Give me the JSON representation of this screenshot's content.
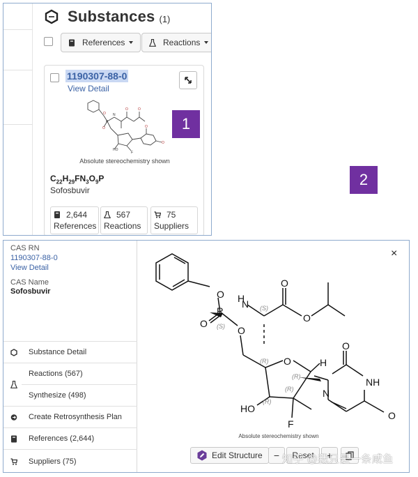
{
  "panel1": {
    "title": "Substances",
    "count": "(1)",
    "buttons": {
      "references": "References",
      "reactions": "Reactions"
    },
    "card": {
      "cas_rn": "1190307-88-0",
      "view_detail": "View Detail",
      "stereo_note": "Absolute stereochemistry shown",
      "formula_parts": [
        "C",
        "22",
        "H",
        "29",
        "FN",
        "3",
        "O",
        "9",
        "P"
      ],
      "name": "Sofosbuvir",
      "stats": [
        {
          "value": "2,644",
          "label": "References",
          "icon": "book-icon"
        },
        {
          "value": "567",
          "label": "Reactions",
          "icon": "flask-icon"
        },
        {
          "value": "75",
          "label": "Suppliers",
          "icon": "cart-icon"
        }
      ]
    }
  },
  "badges": {
    "one": "1",
    "two": "2"
  },
  "panel2": {
    "cas_rn_label": "CAS RN",
    "cas_rn": "1190307-88-0",
    "view_detail": "View Detail",
    "cas_name_label": "CAS Name",
    "cas_name": "Sofosbuvir",
    "menu": {
      "substance_detail": "Substance Detail",
      "reactions": "Reactions (567)",
      "synthesize": "Synthesize (498)",
      "retrosynthesis": "Create Retrosynthesis Plan",
      "references": "References (2,644)",
      "suppliers": "Suppliers (75)"
    },
    "close": "×",
    "stereo_note": "Absolute stereochemistry shown",
    "toolbar": {
      "edit_structure": "Edit Structure",
      "zoom_out": "−",
      "reset": "Reset",
      "zoom_in": "+"
    },
    "atoms": {
      "O": "O",
      "N": "N",
      "P": "P",
      "H": "H",
      "F": "F",
      "HO": "HO",
      "NH": "NH",
      "S": "(S)",
      "R": "(R)"
    }
  },
  "watermark": "知乎 @我只是一条咸鱼",
  "colors": {
    "accent": "#3b62a5",
    "badge": "#7030a0",
    "panel_border": "#8eaacd"
  }
}
